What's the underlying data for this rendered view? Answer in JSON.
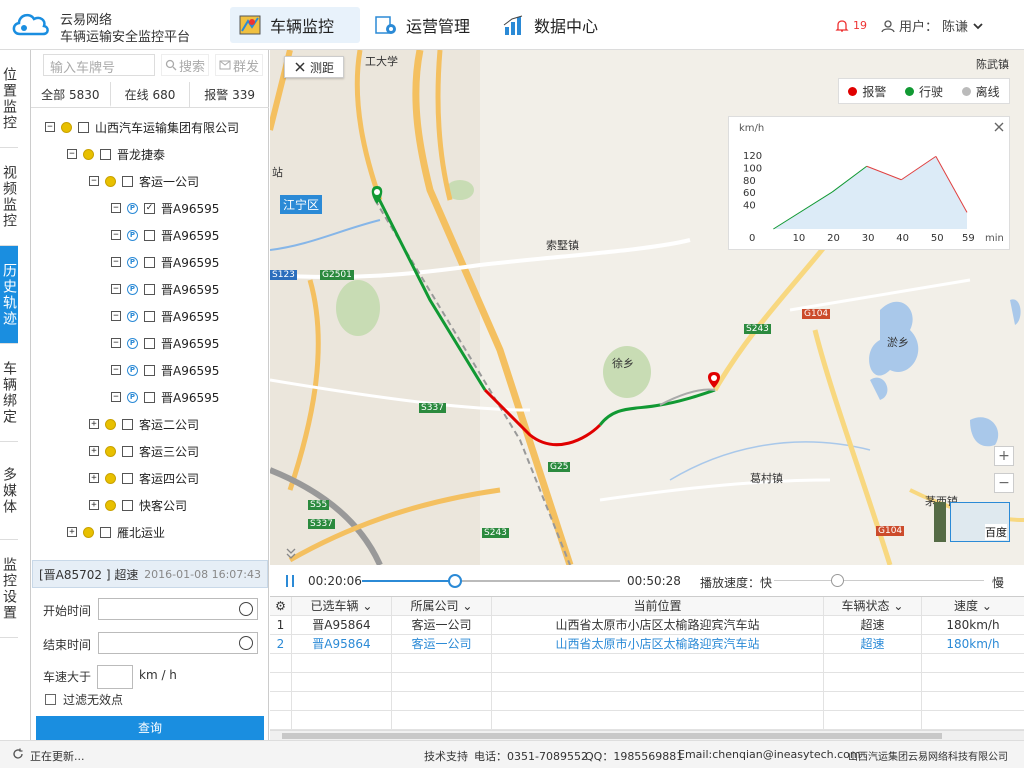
{
  "header": {
    "brand_line1": "云易网络",
    "brand_line2": "车辆运输安全监控平台",
    "nav": [
      {
        "label": "车辆监控",
        "active": true
      },
      {
        "label": "运营管理",
        "active": false
      },
      {
        "label": "数据中心",
        "active": false
      }
    ],
    "alarm_count": "19",
    "user_label": "用户：",
    "user_name": "陈谦"
  },
  "leftnav": [
    {
      "label": "位置监控",
      "active": false
    },
    {
      "label": "视频监控",
      "active": false
    },
    {
      "label": "历史轨迹",
      "active": true
    },
    {
      "label": "车辆绑定",
      "active": false
    },
    {
      "label": "多媒体",
      "active": false
    },
    {
      "label": "监控设置",
      "active": false
    }
  ],
  "panel": {
    "search_placeholder": "输入车牌号",
    "search_btn": "搜索",
    "group_btn": "群发",
    "tabs": [
      {
        "label": "全部",
        "count": "5830"
      },
      {
        "label": "在线",
        "count": "680"
      },
      {
        "label": "报警",
        "count": "339"
      }
    ],
    "tree": [
      {
        "label": "山西汽车运输集团有限公司",
        "level": 0,
        "type": "group",
        "exp": "−",
        "checked": false
      },
      {
        "label": "晋龙捷泰",
        "level": 1,
        "type": "group",
        "exp": "−",
        "checked": false
      },
      {
        "label": "客运一公司",
        "level": 2,
        "type": "group",
        "exp": "−",
        "checked": false
      },
      {
        "label": "晋A96595",
        "level": 3,
        "type": "vehicle",
        "exp": "−",
        "checked": true
      },
      {
        "label": "晋A96595",
        "level": 3,
        "type": "vehicle",
        "exp": "−",
        "checked": false
      },
      {
        "label": "晋A96595",
        "level": 3,
        "type": "vehicle",
        "exp": "−",
        "checked": false
      },
      {
        "label": "晋A96595",
        "level": 3,
        "type": "vehicle",
        "exp": "−",
        "checked": false
      },
      {
        "label": "晋A96595",
        "level": 3,
        "type": "vehicle",
        "exp": "−",
        "checked": false
      },
      {
        "label": "晋A96595",
        "level": 3,
        "type": "vehicle",
        "exp": "−",
        "checked": false
      },
      {
        "label": "晋A96595",
        "level": 3,
        "type": "vehicle",
        "exp": "−",
        "checked": false
      },
      {
        "label": "晋A96595",
        "level": 3,
        "type": "vehicle",
        "exp": "−",
        "checked": false
      },
      {
        "label": "客运二公司",
        "level": 2,
        "type": "group",
        "exp": "+",
        "checked": false
      },
      {
        "label": "客运三公司",
        "level": 2,
        "type": "group",
        "exp": "+",
        "checked": false
      },
      {
        "label": "客运四公司",
        "level": 2,
        "type": "group",
        "exp": "+",
        "checked": false
      },
      {
        "label": "快客公司",
        "level": 2,
        "type": "group",
        "exp": "+",
        "checked": false
      },
      {
        "label": "雁北运业",
        "level": 1,
        "type": "group",
        "exp": "+",
        "checked": false
      }
    ],
    "alarm_plate": "[晋A85702 ] 超速",
    "alarm_time": "2016-01-08 16:07:43",
    "start_label": "开始时间",
    "end_label": "结束时间",
    "speed_label": "车速大于",
    "speed_unit": "km / h",
    "filter_label": "过滤无效点",
    "query_btn": "查询"
  },
  "map": {
    "measure_btn": "测距",
    "legend": [
      {
        "label": "报警",
        "color": "#e00000"
      },
      {
        "label": "行驶",
        "color": "#119933"
      },
      {
        "label": "离线",
        "color": "#bbbbbb"
      }
    ],
    "places": [
      {
        "name": "江宁区"
      },
      {
        "name": "索墅镇"
      },
      {
        "name": "徐乡"
      },
      {
        "name": "葛村镇"
      },
      {
        "name": "茅西镇"
      },
      {
        "name": "陈武镇"
      },
      {
        "name": "淤乡"
      },
      {
        "name": "站"
      },
      {
        "name": "工大学"
      }
    ],
    "road_labels": [
      "S123",
      "G2501",
      "S243",
      "G104",
      "S337",
      "G25",
      "S55",
      "S337",
      "S243",
      "G104"
    ],
    "minimap_label": "百度"
  },
  "chart_data": {
    "type": "area",
    "ylabel": "km/h",
    "xunit": "min",
    "x_ticks": [
      "0",
      "10",
      "20",
      "30",
      "40",
      "50",
      "59"
    ],
    "y_ticks": [
      "40",
      "60",
      "80",
      "100",
      "120"
    ],
    "ylim": [
      0,
      130
    ],
    "xlim": [
      0,
      59
    ],
    "x": [
      3,
      20,
      30,
      40,
      50,
      59
    ],
    "values": [
      0,
      60,
      102,
      80,
      118,
      27
    ]
  },
  "playback": {
    "start": "00:20:06",
    "end": "00:50:28",
    "progress": 0.36,
    "speed_label": "播放速度：快",
    "slow_label": "慢",
    "speed_level": 0.3
  },
  "grid": {
    "headers": [
      "已选车辆",
      "所属公司",
      "当前位置",
      "车辆状态",
      "速度"
    ],
    "rows": [
      {
        "no": "1",
        "plate": "晋A95864",
        "company": "客运一公司",
        "location": "山西省太原市小店区太榆路迎宾汽车站",
        "status": "超速",
        "speed": "180km/h",
        "selected": false
      },
      {
        "no": "2",
        "plate": "晋A95864",
        "company": "客运一公司",
        "location": "山西省太原市小店区太榆路迎宾汽车站",
        "status": "超速",
        "speed": "180km/h",
        "selected": true
      }
    ]
  },
  "footer": {
    "status": "正在更新...",
    "support": "技术支持",
    "phone": "电话：0351-7089552",
    "qq": "QQ：1985569881",
    "email": "Email:chenqian@ineasytech.com",
    "company": "山西汽运集团云易网络科技有限公司"
  }
}
